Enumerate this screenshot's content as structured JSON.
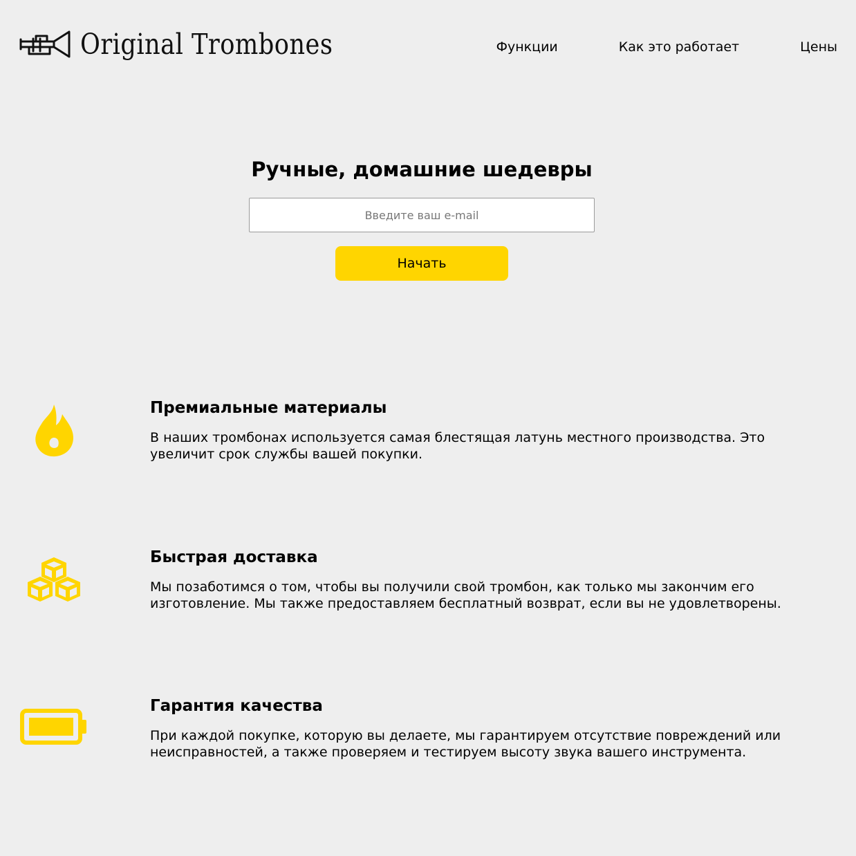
{
  "header": {
    "brand": "Original Trombones",
    "nav": [
      "Функции",
      "Как это работает",
      "Цены"
    ]
  },
  "hero": {
    "title": "Ручные, домашние шедевры",
    "email_placeholder": "Введите ваш e-mail",
    "submit_label": "Начать"
  },
  "features": [
    {
      "icon": "fire-icon",
      "title": "Премиальные материалы",
      "description": "В наших тромбонах используется самая блестящая латунь местного производства. Это увеличит срок службы вашей покупки."
    },
    {
      "icon": "cubes-icon",
      "title": "Быстрая доставка",
      "description": "Мы позаботимся о том, чтобы вы получили свой тромбон, как только мы закончим его изготовление. Мы также предоставляем бесплатный возврат, если вы не удовлетворены."
    },
    {
      "icon": "battery-full-icon",
      "title": "Гарантия качества",
      "description": "При каждой покупке, которую вы делаете, мы гарантируем отсутствие повреждений или неисправностей, а также проверяем и тестируем высоту звука вашего инструмента."
    }
  ],
  "colors": {
    "accent": "#ffd500",
    "background": "#eeeeee",
    "text": "#000000"
  }
}
